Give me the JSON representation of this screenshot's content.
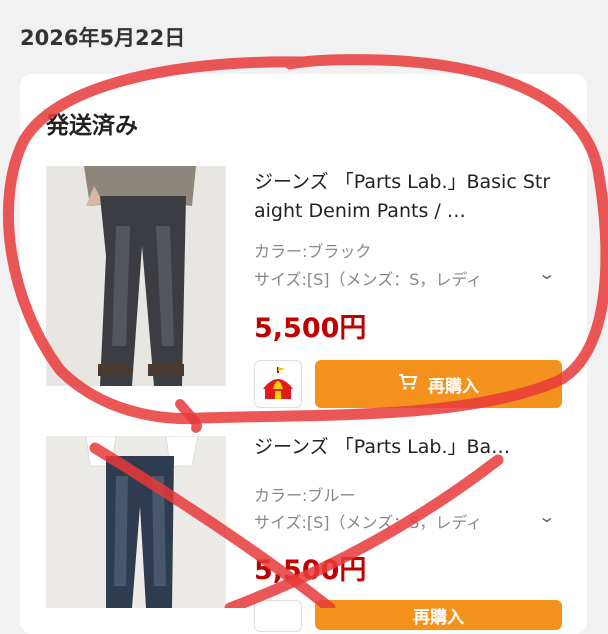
{
  "order": {
    "date": "2026年5月22日",
    "status": "発送済み"
  },
  "items": [
    {
      "title": "ジーンズ 「Parts Lab.」Basic Straight Denim Pants / …",
      "color": "カラー:ブラック",
      "size": "サイズ:[S]（メンズ：S，レディ",
      "price": "5,500円",
      "rebuy_label": "再購入"
    },
    {
      "title": "ジーンズ 「Parts Lab.」Ba…",
      "color": "カラー:ブルー",
      "size": "サイズ:[S]（メンズ：S，レディ",
      "price": "5,500円",
      "rebuy_label": "再購入"
    }
  ],
  "colors": {
    "price": "#bf0000",
    "rebuy_button": "#f5921e",
    "annotation": "#e83a3a"
  },
  "icons": {
    "cart": "cart-icon",
    "shop": "circus-tent-shop-icon",
    "expand": "chevron-down-icon"
  }
}
